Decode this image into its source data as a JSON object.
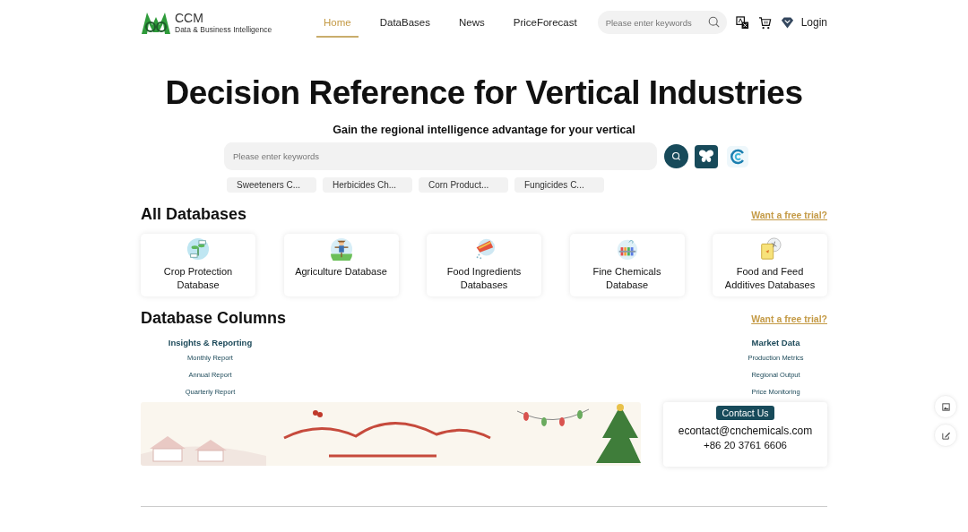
{
  "header": {
    "logo": {
      "name": "CCM",
      "tagline": "Data & Business Intelligence"
    },
    "nav": [
      {
        "label": "Home",
        "selected": true
      },
      {
        "label": "DataBases",
        "selected": false
      },
      {
        "label": "News",
        "selected": false
      },
      {
        "label": "PriceForecast",
        "selected": false
      }
    ],
    "search": {
      "placeholder": "Please enter keywords"
    },
    "login": "Login"
  },
  "hero": {
    "title": "Decision Reference for Vertical Industries",
    "subtitle": "Gain the regional intelligence advantage for your vertical",
    "search": {
      "placeholder": "Please enter keywords"
    },
    "chips": [
      "Sweeteners C...",
      "Herbicides Ch...",
      "Corn Product...",
      "Fungicides C..."
    ]
  },
  "databases": {
    "title": "All Databases",
    "trial_link": "Want a free trial?",
    "cards": [
      {
        "label": "Crop Protection Database",
        "kind": "crop"
      },
      {
        "label": "Agriculture Database",
        "kind": "agri"
      },
      {
        "label": "Food Ingredients Databases",
        "kind": "food"
      },
      {
        "label": "Fine Chemicals Database",
        "kind": "chem"
      },
      {
        "label": "Food and Feed Additives Databases",
        "kind": "feed"
      }
    ]
  },
  "columns": {
    "title": "Database Columns",
    "trial_link": "Want a free trial?",
    "groups": [
      {
        "heading": "Insights & Reporting",
        "items": [
          "Monthly Report",
          "Annual Report",
          "Quarterly Report"
        ]
      },
      {
        "heading": "Market Data",
        "items": [
          "Production Metrics",
          "Regional Output",
          "Price Monitoring"
        ]
      }
    ]
  },
  "contact": {
    "button": "Contact Us",
    "email": "econtact@cnchemicals.com",
    "phone": "+86 20 3761 6606"
  }
}
